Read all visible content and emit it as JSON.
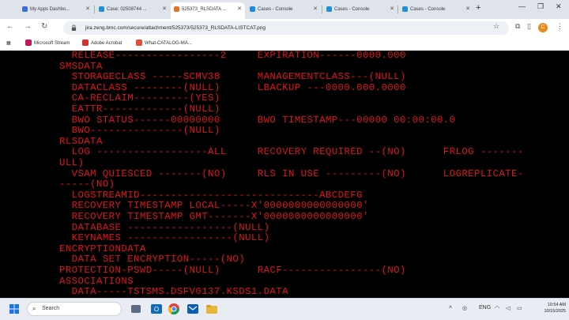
{
  "browser": {
    "tabs": [
      {
        "label": "My Apps Dashbo...",
        "color": "#3b6fd8",
        "active": false
      },
      {
        "label": "Case: 02508744 ...",
        "color": "#1d8fd8",
        "active": false
      },
      {
        "label": "525373_RLSDATA ...",
        "color": "#e0762a",
        "active": true
      },
      {
        "label": "Cases - Console",
        "color": "#1d8fd8",
        "active": false
      },
      {
        "label": "Cases - Console",
        "color": "#1d8fd8",
        "active": false
      },
      {
        "label": "Cases - Console",
        "color": "#1d8fd8",
        "active": false
      }
    ],
    "url": "jira.zeng.bmc.com/secure/attachment/525373/525373_RLSDATA-LISTCAT.png",
    "bookmarks": [
      "Microsoft Stream",
      "Adobe Acrobat",
      "What-CATALOG-MA..."
    ]
  },
  "terminal": {
    "color": "#e0141a",
    "lines": [
      "  RELEASE-----------------2     EXPIRATION------0000.000",
      "SMSDATA",
      "  STORAGECLASS -----SCMV38      MANAGEMENTCLASS---(NULL)",
      "  DATACLASS --------(NULL)      LBACKUP ---0000.000.0000",
      "  CA-RECLAIM---------(YES)",
      "  EATTR-------------(NULL)",
      "  BWO STATUS------00000000      BWO TIMESTAMP---00000 00:00:00.0",
      "  BWO---------------(NULL)",
      "RLSDATA",
      "  LOG ------------------ALL     RECOVERY REQUIRED --(NO)      FRLOG -------",
      "ULL)",
      "  VSAM QUIESCED -------(NO)     RLS IN USE ---------(NO)      LOGREPLICATE-",
      "-----(NO)",
      "  LOGSTREAMID-----------------------------ABCDEFG",
      "  RECOVERY TIMESTAMP LOCAL-----X'0000000000000000'",
      "  RECOVERY TIMESTAMP GMT-------X'0000000000000000'",
      "  DATABASE -----------------(NULL)",
      "  KEYNAMES -----------------(NULL)",
      "ENCRYPTIONDATA",
      "  DATA SET ENCRYPTION-----(NO)",
      "PROTECTION-PSWD-----(NULL)      RACF----------------(NO)",
      "ASSOCIATIONS",
      "  DATA-----TSTSMS.DSFV0137.KSDS1.DATA"
    ]
  },
  "taskbar": {
    "search_label": "Search",
    "lang": "ENG",
    "time": "10:54 AM",
    "date": "10/15/2025"
  }
}
